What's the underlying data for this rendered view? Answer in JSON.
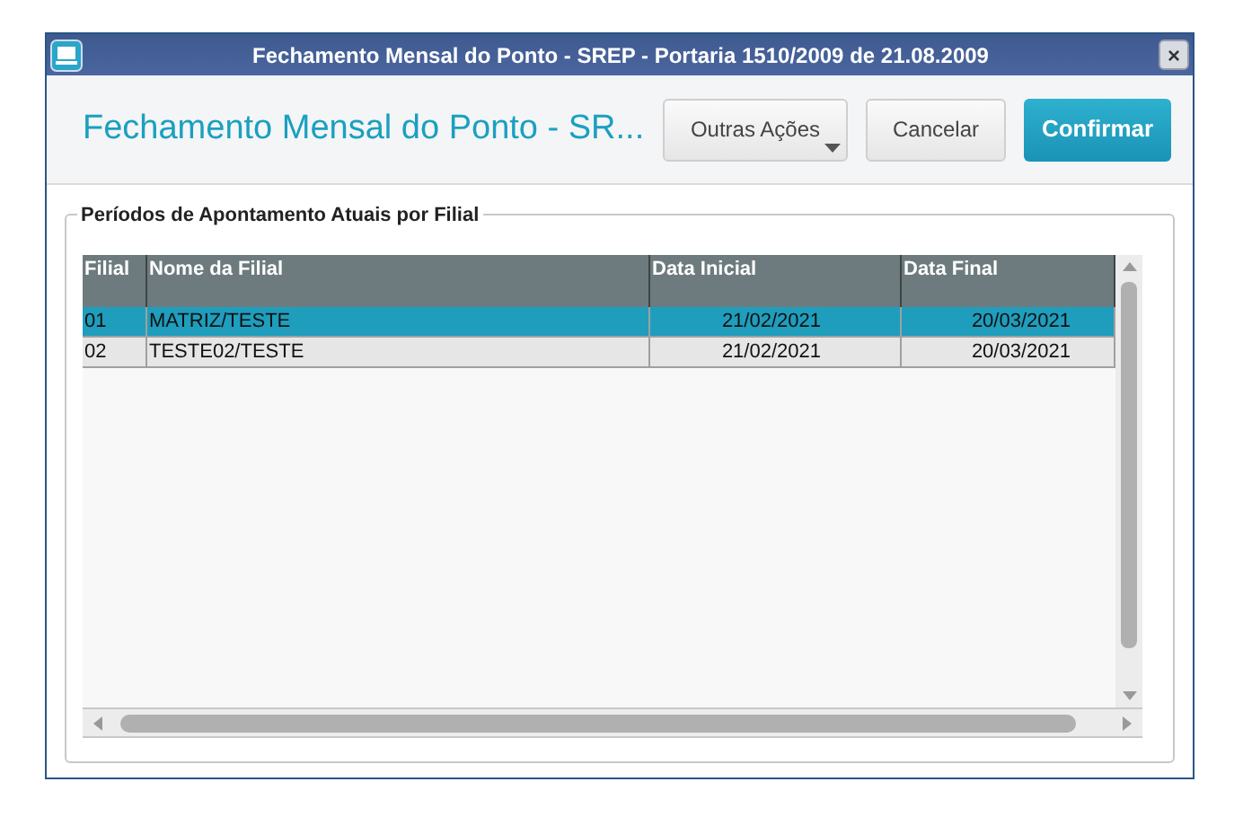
{
  "window": {
    "title": "Fechamento Mensal do Ponto - SREP - Portaria 1510/2009 de 21.08.2009",
    "close": "×"
  },
  "header": {
    "title": "Fechamento Mensal do Ponto - SR...",
    "buttons": [
      {
        "label": "Outras Ações",
        "kind": "menu"
      },
      {
        "label": "Cancelar",
        "kind": "secondary"
      },
      {
        "label": "Confirmar",
        "kind": "primary"
      }
    ]
  },
  "group": {
    "title": "Períodos de Apontamento Atuais por Filial"
  },
  "table": {
    "columns": [
      "Filial",
      "Nome da Filial",
      "Data Inicial",
      "Data Final"
    ],
    "rows": [
      {
        "cells": [
          "01",
          "MATRIZ/TESTE",
          "21/02/2021",
          "20/03/2021"
        ],
        "selected": true
      },
      {
        "cells": [
          "02",
          "TESTE02/TESTE",
          "21/02/2021",
          "20/03/2021"
        ],
        "selected": false
      }
    ]
  }
}
